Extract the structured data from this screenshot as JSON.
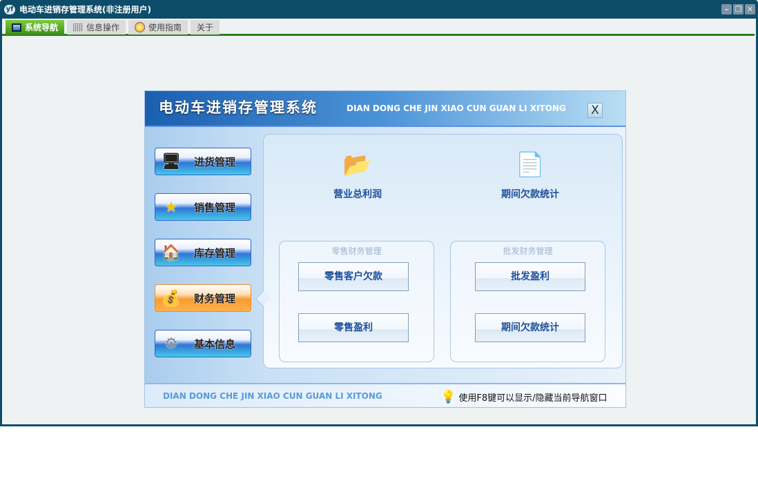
{
  "window": {
    "title": "电动车进销存管理系统(非注册用户)",
    "app_icon": "yf",
    "controls": {
      "minimize": "–",
      "restore": "❐",
      "close": "✕"
    }
  },
  "tabs": [
    {
      "label": "系统导航",
      "icon": "monitor-icon"
    },
    {
      "label": "信息操作",
      "icon": "grid-icon"
    },
    {
      "label": "使用指南",
      "icon": "help-icon"
    },
    {
      "label": "关于"
    }
  ],
  "panel": {
    "title": "电动车进销存管理系统",
    "subtitle": "DIAN DONG CHE JIN XIAO CUN GUAN LI XITONG",
    "close": "X",
    "nav": [
      {
        "label": "进货管理",
        "icon": "monitor-icon"
      },
      {
        "label": "销售管理",
        "icon": "star-icon"
      },
      {
        "label": "库存管理",
        "icon": "house-icon"
      },
      {
        "label": "财务管理",
        "icon": "coins-icon",
        "active": true
      },
      {
        "label": "基本信息",
        "icon": "gear-icon"
      }
    ],
    "top_items": [
      {
        "label": "营业总利润",
        "icon": "folder-coins-icon"
      },
      {
        "label": "期间欠款统计",
        "icon": "document-coins-icon"
      }
    ],
    "groups": [
      {
        "title": "零售财务管理",
        "buttons": [
          "零售客户欠款",
          "零售盈利"
        ]
      },
      {
        "title": "批发财务管理",
        "buttons": [
          "批发盈利",
          "期间欠款统计"
        ]
      }
    ],
    "footer": {
      "subtitle": "DIAN DONG CHE JIN XIAO CUN GUAN LI XITONG",
      "tip": "使用F8键可以显示/隐藏当前导航窗口"
    }
  },
  "colors": {
    "titlebar": "#0e4d6a",
    "tab_active": "#3b9116",
    "accent": "#1d4f9c",
    "nav_active": "#fb9a30"
  }
}
